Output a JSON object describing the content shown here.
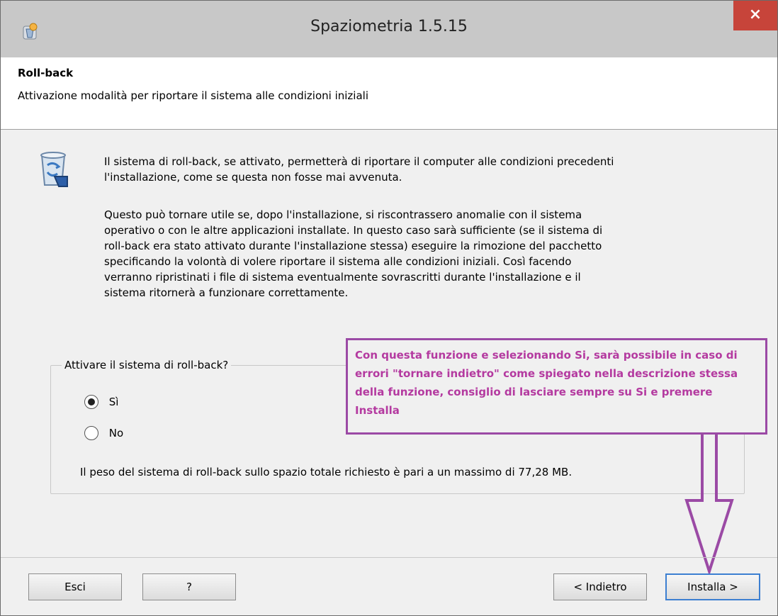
{
  "window": {
    "title": "Spaziometria 1.5.15",
    "close_label": "×"
  },
  "header": {
    "title": "Roll-back",
    "subtitle": "Attivazione modalità per riportare il sistema alle condizioni iniziali"
  },
  "content": {
    "paragraph1": "Il sistema di roll-back, se attivato, permetterà di riportare il computer alle condizioni precedenti\nl'installazione, come se questa non fosse mai avvenuta.",
    "paragraph2": "Questo può tornare utile se, dopo l'installazione, si riscontrassero anomalie con il sistema\noperativo o con le altre applicazioni installate. In questo caso sarà sufficiente (se il sistema di\nroll-back era stato attivato durante l'installazione stessa) eseguire la rimozione del pacchetto\nspecificando la volontà di volere riportare il sistema alle condizioni iniziali. Così facendo\nverranno ripristinati i file di sistema eventualmente sovrascritti durante l'installazione e il\nsistema ritornerà a funzionare correttamente."
  },
  "rollback_group": {
    "legend": "Attivare il sistema di roll-back?",
    "options": [
      {
        "label": "Sì",
        "checked": true
      },
      {
        "label": "No",
        "checked": false
      }
    ],
    "size_note": "Il peso del sistema di roll-back sullo spazio totale richiesto è pari a un massimo di  77,28 MB."
  },
  "annotation": {
    "text": "Con questa funzione e selezionando Si, sarà possibile in caso di errori \"tornare indietro\" come spiegato nella descrizione stessa della funzione, consiglio di lasciare sempre su Si e premere Installa",
    "color": "#b43aa0",
    "border_color": "#9b4aa5"
  },
  "footer": {
    "exit_label": "Esci",
    "help_label": "?",
    "back_label": "< Indietro",
    "install_label": "Installa >"
  },
  "icons": {
    "app": "installer-app-icon",
    "setup": "recycle-bin-setup-icon",
    "close": "close-icon",
    "arrow": "down-arrow-annotation-icon"
  }
}
